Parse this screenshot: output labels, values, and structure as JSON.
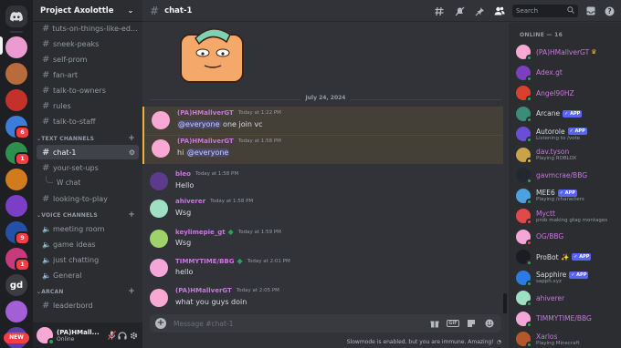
{
  "guild": {
    "name": "Project Axolottle"
  },
  "servers": [
    {
      "initials": "",
      "color": "#ec9bd1"
    },
    {
      "initials": "",
      "color": "#b86b3c"
    },
    {
      "initials": "",
      "color": "#c4312b"
    },
    {
      "initials": "",
      "color": "#3b7dd8",
      "badge": "6"
    },
    {
      "initials": "",
      "color": "#2f8f4e",
      "badge": "1"
    },
    {
      "initials": "",
      "color": "#d17a1e"
    },
    {
      "initials": "",
      "color": "#7a3fc4"
    },
    {
      "initials": "",
      "color": "#2450a8",
      "badge": "9"
    },
    {
      "initials": "",
      "color": "#c73a7b",
      "badge": "1"
    },
    {
      "initials": "gd",
      "color": "#3a3c42"
    },
    {
      "initials": "",
      "color": "#a35fd6"
    },
    {
      "initials": "",
      "color": "#5b3ea8"
    }
  ],
  "new_label": "NEW",
  "channels": {
    "top": [
      "tuts-on-things-like-editi...",
      "sneek-peaks",
      "self-prom",
      "fan-art",
      "talk-to-owners",
      "rules",
      "talk-to-staff"
    ],
    "text_category": "TEXT CHANNELS",
    "text": [
      {
        "name": "chat-1",
        "active": true
      },
      {
        "name": "your-set-ups"
      }
    ],
    "thread": "W chat",
    "text_after": [
      "looking-to-play"
    ],
    "voice_category": "VOICE CHANNELS",
    "voice": [
      "meeting room",
      "game ideas",
      "just chatting",
      "General"
    ],
    "arcan_category": "ARCAN",
    "arcan": [
      "leaderbord"
    ]
  },
  "user": {
    "name": "(PA)HMall...",
    "status": "Online"
  },
  "chat": {
    "channel": "chat-1",
    "date_divider": "July 24, 2024",
    "messages": [
      {
        "author": "(PA)HMallverGT",
        "color": "#c778dd",
        "time": "Today at 1:22 PM",
        "pre": "",
        "mention": "@everyone",
        "post": " one join vc",
        "highlight": true,
        "avatar": "#f9a8d4"
      },
      {
        "author": "(PA)HMallverGT",
        "color": "#c778dd",
        "time": "Today at 1:58 PM",
        "pre": "hi ",
        "mention": "@everyone",
        "post": "",
        "highlight": true,
        "avatar": "#f9a8d4"
      },
      {
        "author": "bleo",
        "color": "#c778dd",
        "time": "Today at 1:58 PM",
        "pre": "Hello",
        "avatar": "#5e3a8c"
      },
      {
        "author": "ahiverer",
        "color": "#c778dd",
        "time": "Today at 1:58 PM",
        "pre": "Wsg",
        "avatar": "#9fe0c5"
      },
      {
        "author": "keylimepie_gt",
        "color": "#c778dd",
        "time": "Today at 1:59 PM",
        "pre": "Wsg",
        "role_icon": true,
        "avatar": "#9ed36a"
      },
      {
        "author": "TIMMYTIME/BBG",
        "color": "#c778dd",
        "time": "Today at 2:01 PM",
        "pre": "hello",
        "role_icon": true,
        "avatar": "#f4a6d8"
      },
      {
        "author": "(PA)HMallverGT",
        "color": "#c778dd",
        "time": "Today at 2:05 PM",
        "pre": "what you guys doin",
        "avatar": "#f9a8d4"
      }
    ],
    "composer_placeholder": "Message #chat-1",
    "slowmode": "Slowmode is enabled, but you are immune. Amazing!"
  },
  "toolbar": {
    "search_placeholder": "Search"
  },
  "members": {
    "header": "ONLINE — 16",
    "list": [
      {
        "name": "(PA)HMallverGT",
        "color": "#c778dd",
        "crown": "♛",
        "avatar": "#f9a8d4",
        "status": "online"
      },
      {
        "name": "Adex.gt",
        "color": "#c778dd",
        "avatar": "#7b3fbf",
        "status": "online"
      },
      {
        "name": "Angel90HZ",
        "color": "#c778dd",
        "avatar": "#d9412f",
        "status": "online"
      },
      {
        "name": "Arcane",
        "color": "#dbdee1",
        "app": "✓ APP",
        "avatar": "#3c8c7a",
        "status": "online"
      },
      {
        "name": "Autorole",
        "color": "#dbdee1",
        "app": "✓ APP",
        "activity": "Listening to /vote",
        "avatar": "#6c4ed6",
        "status": "online"
      },
      {
        "name": "dav.tyson",
        "color": "#c778dd",
        "activity": "Playing ROBLOX",
        "avatar": "#caa24a",
        "status": "idle"
      },
      {
        "name": "gavmcrae/BBG",
        "color": "#c778dd",
        "avatar": "#23272f",
        "status": "online"
      },
      {
        "name": "MEE6",
        "color": "#dbdee1",
        "app": "✓ APP",
        "activity": "Playing /characters",
        "avatar": "#4aa3df",
        "status": "online"
      },
      {
        "name": "Myctt",
        "color": "#c778dd",
        "activity": "prob making gtag montages",
        "avatar": "#e24a4a",
        "status": "dnd"
      },
      {
        "name": "OG/BBG",
        "color": "#c778dd",
        "avatar": "#f4a6d8",
        "status": "dnd"
      },
      {
        "name": "ProBot ✨",
        "color": "#dbdee1",
        "app": "✓ APP",
        "avatar": "#1b1d22",
        "status": "online"
      },
      {
        "name": "Sapphire",
        "color": "#dbdee1",
        "app": "✓ APP",
        "activity": "sapph.xyz",
        "avatar": "#2c7be5",
        "status": "online"
      },
      {
        "name": "ahiverer",
        "color": "#c778dd",
        "avatar": "#9fe0c5",
        "status": "online"
      },
      {
        "name": "TIMMYTIME/BBG",
        "color": "#c778dd",
        "avatar": "#f4a6d8",
        "status": "online"
      },
      {
        "name": "Xarlos",
        "color": "#c778dd",
        "activity": "Playing Minecraft",
        "avatar": "#b2582c",
        "status": "online"
      }
    ]
  }
}
